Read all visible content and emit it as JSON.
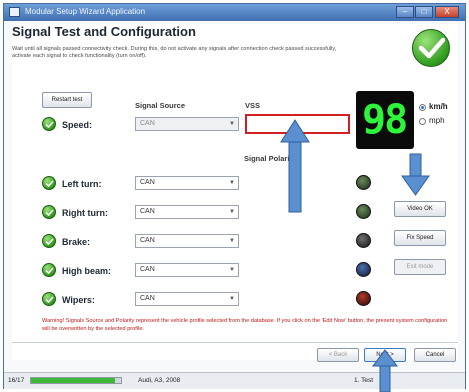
{
  "window": {
    "title": "Modular Setup Wizard Application",
    "minimize": "–",
    "maximize": "□",
    "close": "X"
  },
  "page": {
    "heading": "Signal Test and Configuration",
    "instructions": "Wait until all signals passed connectivity check. During this, do not activate any signals after connection check passed successfully, activate each signal to check functionality (turn on/off)."
  },
  "controls": {
    "restart_test": "Restart test",
    "signal_source_label": "Signal Source",
    "vss_label": "VSS",
    "signal_polarity_label": "Signal Polarity",
    "vss_value": ""
  },
  "speed_display": {
    "value": "98",
    "unit_kmh": "km/h",
    "unit_mph": "mph",
    "selected_unit": "km/h"
  },
  "signals": [
    {
      "label": "Speed:",
      "source": "CAN",
      "enabled": false
    },
    {
      "label": "Left turn:",
      "source": "CAN",
      "enabled": true
    },
    {
      "label": "Right turn:",
      "source": "CAN",
      "enabled": true
    },
    {
      "label": "Brake:",
      "source": "CAN",
      "enabled": true
    },
    {
      "label": "High beam:",
      "source": "CAN",
      "enabled": true
    },
    {
      "label": "Wipers:",
      "source": "CAN",
      "enabled": true
    }
  ],
  "side_buttons": {
    "video_ok": "Video OK",
    "fix_speed": "Fix Speed",
    "third": "Exit mode"
  },
  "warning": "Warning! Signals Source and Polarity represent the vehicle profile selected from the database. If you click on the 'Edit Now' button, the present system configuration will be overwritten by the selected profile.",
  "footer": {
    "back": "< Back",
    "next": "Next >",
    "cancel": "Cancel"
  },
  "status_bar": {
    "step": "16/17",
    "progress": 0.93,
    "vehicle": "Audi, A3, 2008",
    "right": "1. Test"
  },
  "colors": {
    "accent_blue": "#5a8fd0",
    "check_green": "#2f9b1e",
    "vss_border_red": "#d22020",
    "display_green": "#2df53a",
    "warning_red": "#c01818"
  }
}
